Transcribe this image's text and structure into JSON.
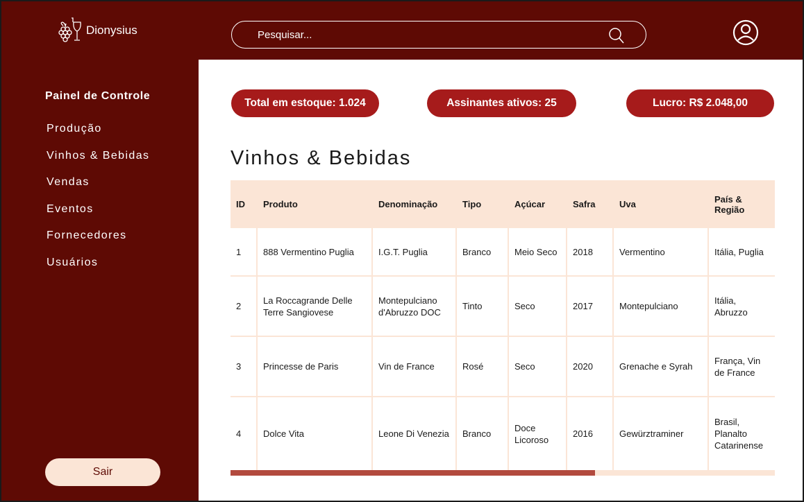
{
  "app": {
    "name": "Dionysius"
  },
  "search": {
    "placeholder": "Pesquisar..."
  },
  "sidebar": {
    "title": "Painel de Controle",
    "items": [
      {
        "label": "Produção"
      },
      {
        "label": "Vinhos & Bebidas"
      },
      {
        "label": "Vendas"
      },
      {
        "label": "Eventos"
      },
      {
        "label": "Fornecedores"
      },
      {
        "label": "Usuários"
      }
    ],
    "logout_label": "Sair"
  },
  "stats": [
    {
      "label": "Total em estoque: 1.024"
    },
    {
      "label": "Assinantes ativos: 25"
    },
    {
      "label": "Lucro: R$ 2.048,00"
    }
  ],
  "page": {
    "title": "Vinhos & Bebidas"
  },
  "table": {
    "headers": [
      "ID",
      "Produto",
      "Denominação",
      "Tipo",
      "Açúcar",
      "Safra",
      "Uva",
      "País & Região"
    ],
    "rows": [
      [
        "1",
        "888 Vermentino Puglia",
        "I.G.T. Puglia",
        "Branco",
        "Meio Seco",
        "2018",
        "Vermentino",
        "Itália, Puglia"
      ],
      [
        "2",
        "La Roccagrande Delle Terre Sangiovese",
        "Montepulciano d'Abruzzo DOC",
        "Tinto",
        "Seco",
        "2017",
        "Montepulciano",
        "Itália, Abruzzo"
      ],
      [
        "3",
        "Princesse de Paris",
        "Vin de France",
        "Rosé",
        "Seco",
        "2020",
        "Grenache e Syrah",
        "França, Vin de France"
      ],
      [
        "4",
        "Dolce Vita",
        "Leone Di Venezia",
        "Branco",
        "Doce Licoroso",
        "2016",
        "Gewürztraminer",
        "Brasil, Planalto Catarinense"
      ]
    ],
    "scroll_position": 0.67
  },
  "colors": {
    "brand": "#5e0a04",
    "accent": "#a61b1b",
    "light": "#fbe5d6",
    "scroll_thumb": "#b24a3e"
  },
  "icons": {
    "logo": "wine-grapes-icon",
    "search": "search-icon",
    "user": "user-avatar-icon"
  }
}
